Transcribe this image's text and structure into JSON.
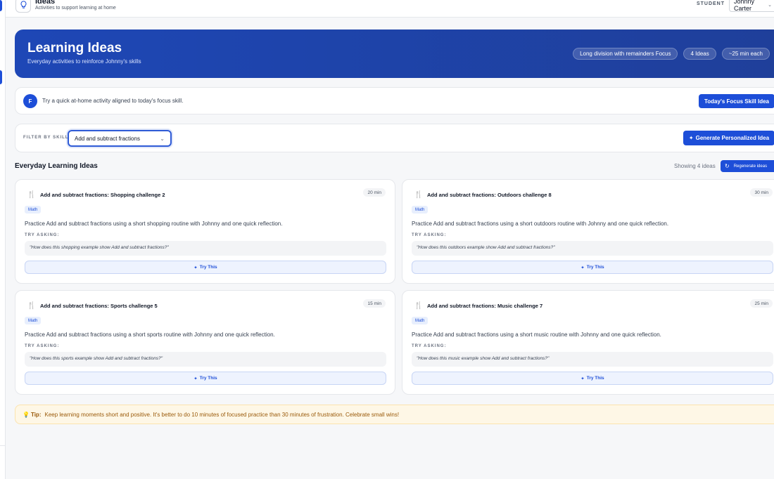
{
  "header": {
    "title": "Ideas",
    "subtitle": "Activities to support learning at home",
    "student_label": "STUDENT",
    "student_name": "Johnny Carter"
  },
  "hero": {
    "title": "Learning Ideas",
    "subtitle": "Everyday activities to reinforce Johnny's skills",
    "chips": [
      "Long division with remainders Focus",
      "4 Ideas",
      "~25 min each"
    ]
  },
  "focus": {
    "avatar": "F",
    "text": "Try a quick at-home activity aligned to today's focus skill.",
    "button": "Today's Focus Skill Idea"
  },
  "filter": {
    "label": "FILTER BY SKILL:",
    "selected": "Add and subtract fractions",
    "generate_button": "Generate Personalized Idea"
  },
  "ideas_section": {
    "title": "Everyday Learning Ideas",
    "showing": "Showing 4 ideas",
    "regenerate_button": "Regenerate ideas"
  },
  "cards": [
    {
      "title": "Add and subtract fractions: Shopping challenge 2",
      "minutes": "20 min",
      "tag": "Math",
      "description": "Practice Add and subtract fractions using a short shopping routine with Johnny and one quick reflection.",
      "try_label": "TRY ASKING:",
      "quote": "\"How does this shopping example show Add and subtract fractions?\"",
      "button": "Try This"
    },
    {
      "title": "Add and subtract fractions: Outdoors challenge 8",
      "minutes": "30 min",
      "tag": "Math",
      "description": "Practice Add and subtract fractions using a short outdoors routine with Johnny and one quick reflection.",
      "try_label": "TRY ASKING:",
      "quote": "\"How does this outdoors example show Add and subtract fractions?\"",
      "button": "Try This"
    },
    {
      "title": "Add and subtract fractions: Sports challenge 5",
      "minutes": "15 min",
      "tag": "Math",
      "description": "Practice Add and subtract fractions using a short sports routine with Johnny and one quick reflection.",
      "try_label": "TRY ASKING:",
      "quote": "\"How does this sports example show Add and subtract fractions?\"",
      "button": "Try This"
    },
    {
      "title": "Add and subtract fractions: Music challenge 7",
      "minutes": "25 min",
      "tag": "Math",
      "description": "Practice Add and subtract fractions using a short music routine with Johnny and one quick reflection.",
      "try_label": "TRY ASKING:",
      "quote": "\"How does this music example show Add and subtract fractions?\"",
      "button": "Try This"
    }
  ],
  "tip": {
    "label": "Tip:",
    "text": "Keep learning moments short and positive. It's better to do 10 minutes of focused practice than 30 minutes of frustration. Celebrate small wins!"
  },
  "icons": {
    "header": "lightbulb-icon",
    "card": "utensils-icon",
    "sparkle": "sparkle-icon",
    "refresh": "refresh-icon",
    "tip": "lightbulb-icon",
    "chevron": "chevron-down-icon"
  },
  "colors": {
    "primary": "#1d4ed8",
    "hero_start": "#1e47b6",
    "tip_bg": "#fef7e6",
    "tip_text": "#9a5a0a",
    "icon_accent": "#d97706"
  }
}
